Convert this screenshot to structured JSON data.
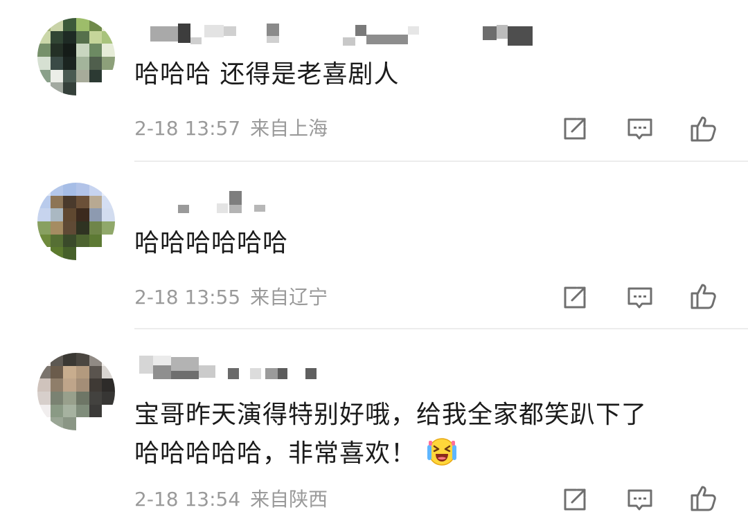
{
  "comments": [
    {
      "text_lines": [
        "哈哈哈 还得是老喜剧人"
      ],
      "time": "2-18 13:57",
      "location": "来自上海"
    },
    {
      "text_lines": [
        "哈哈哈哈哈哈"
      ],
      "time": "2-18 13:55",
      "location": "来自辽宁"
    },
    {
      "text_lines": [
        "宝哥昨天演得特别好哦，给我全家都笑趴下了",
        "哈哈哈哈哈，非常喜欢！"
      ],
      "time": "2-18 13:54",
      "location": "来自陕西",
      "emoji": "laughing-crying-emoji"
    }
  ],
  "icons": {
    "share": "share-icon",
    "reply": "comment-icon",
    "like": "thumbs-up-icon"
  },
  "colors": {
    "text": "#1b1b1b",
    "meta": "#9a9a9a",
    "icon": "#6f6f6f",
    "divider": "#ececec"
  }
}
